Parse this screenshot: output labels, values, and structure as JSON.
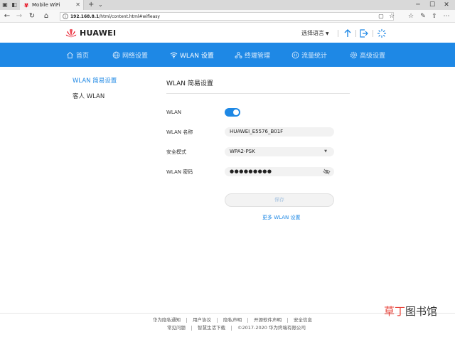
{
  "browser": {
    "tab_title": "Mobile WiFi",
    "url_host": "192.168.8.1",
    "url_path": "/html/content.html#wifieasy",
    "icons": [
      "back-arrow-icon",
      "forward-arrow-icon",
      "refresh-icon",
      "home-icon",
      "reading-view-icon",
      "star-icon",
      "favorites-icon",
      "pen-icon",
      "share-icon",
      "more-icon"
    ]
  },
  "header": {
    "brand": "HUAWEI",
    "language_label": "选择语言",
    "brand_color": "#e60012"
  },
  "nav": {
    "items": [
      {
        "label": "首页",
        "icon": "home-icon"
      },
      {
        "label": "网络设置",
        "icon": "globe-icon"
      },
      {
        "label": "WLAN 设置",
        "icon": "wifi-icon"
      },
      {
        "label": "终端管理",
        "icon": "devices-icon"
      },
      {
        "label": "流量统计",
        "icon": "data-usage-icon"
      },
      {
        "label": "高级设置",
        "icon": "gear-icon"
      }
    ],
    "active": "WLAN 设置",
    "bg_color": "#1e88e5"
  },
  "sidebar": {
    "items": [
      {
        "label": "WLAN 简易设置",
        "active": true
      },
      {
        "label": "客人 WLAN",
        "active": false
      }
    ]
  },
  "main": {
    "title": "WLAN 简易设置",
    "wlan_label": "WLAN",
    "wlan_enabled": true,
    "ssid_label": "WLAN 名称",
    "ssid_value": "HUAWEI_E5576_B01F",
    "security_label": "安全模式",
    "security_value": "WPA2-PSK",
    "password_label": "WLAN 密码",
    "password_value": "●●●●●●●●●",
    "save_label": "保存",
    "more_link": "更多 WLAN 设置"
  },
  "footer": {
    "row1": [
      "华为隐私通知",
      "用户协议",
      "隐私声明",
      "开源软件声明",
      "安全信息"
    ],
    "row2": [
      "常见问题",
      "智慧生活下载",
      "©2017-2020 华为终端有限公司"
    ]
  },
  "watermark": {
    "part1": "草丁",
    "part2": "图书馆"
  }
}
